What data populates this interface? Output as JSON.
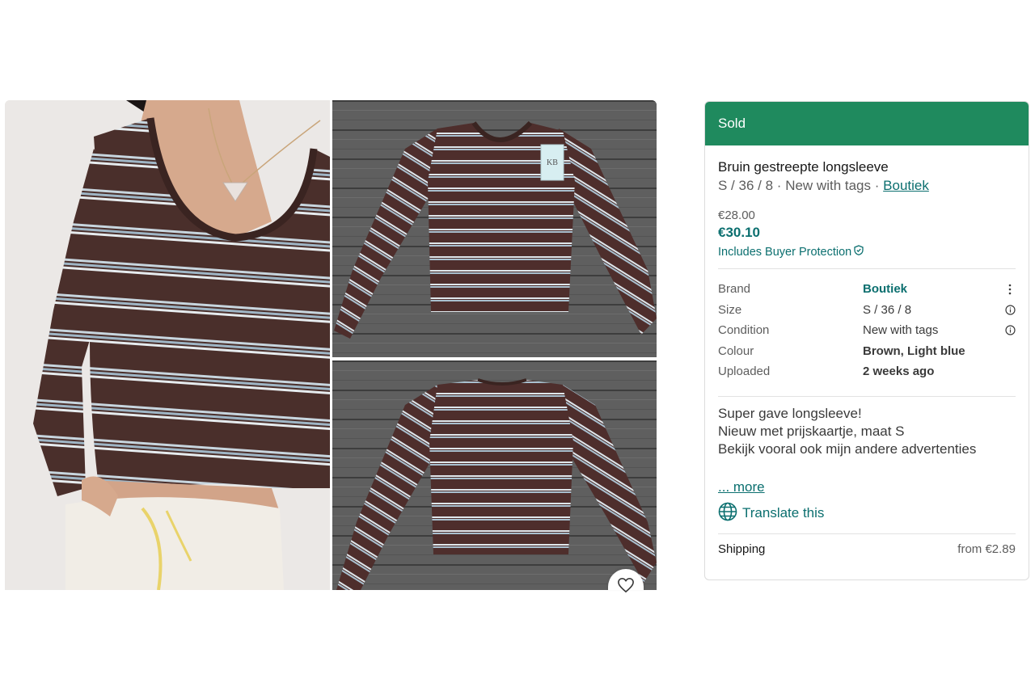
{
  "gallery": {
    "photos": [
      "photo-main",
      "photo-front",
      "photo-back"
    ],
    "tag_text": "KB",
    "favourite_icon": "heart-icon"
  },
  "status": {
    "label": "Sold",
    "color": "#1f8a5e"
  },
  "item": {
    "title": "Bruin gestreepte longsleeve",
    "subtitle_size": "S / 36 / 8",
    "subtitle_condition": "New with tags",
    "separator": "·",
    "brand_link": "Boutiek"
  },
  "price": {
    "original": "€28.00",
    "total": "€30.10",
    "protection_label": "Includes Buyer Protection"
  },
  "details": [
    {
      "key": "Brand",
      "value": "Boutiek",
      "icon": "more-vertical-icon"
    },
    {
      "key": "Size",
      "value": "S / 36 / 8",
      "icon": "info-icon"
    },
    {
      "key": "Condition",
      "value": "New with tags",
      "icon": "info-icon"
    },
    {
      "key": "Colour",
      "value": "Brown, Light blue",
      "icon": ""
    },
    {
      "key": "Uploaded",
      "value": "2 weeks ago",
      "icon": ""
    }
  ],
  "description": {
    "lines": [
      "Super gave longsleeve!",
      "Nieuw met prijskaartje, maat S",
      "Bekijk vooral ook mijn andere advertenties"
    ],
    "more_label": "... more",
    "translate_label": "Translate this"
  },
  "shipping": {
    "label": "Shipping",
    "value": "from €2.89"
  },
  "colors": {
    "accent": "#0b6f6f",
    "sold_banner": "#1f8a5e",
    "shirt_brown": "#4a2f2b",
    "stripe_blue": "#a9c0cf"
  }
}
